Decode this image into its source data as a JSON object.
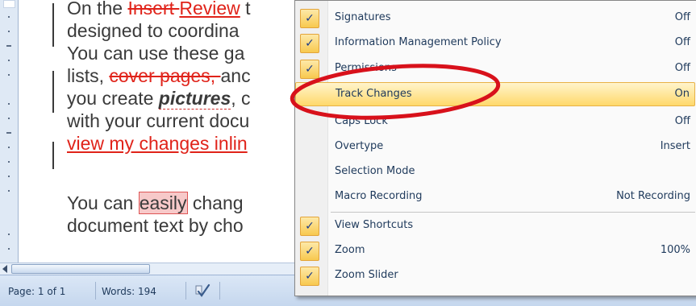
{
  "document": {
    "lines": [
      {
        "parts": [
          [
            "plain",
            "On the "
          ],
          [
            "del",
            "Insert "
          ],
          [
            "ins",
            "Review"
          ],
          [
            "plain",
            " t"
          ]
        ]
      },
      {
        "parts": [
          [
            "plain",
            "designed to coordina"
          ]
        ]
      },
      {
        "parts": [
          [
            "plain",
            "You can use these ga"
          ]
        ]
      },
      {
        "parts": [
          [
            "plain",
            "lists, "
          ],
          [
            "del",
            "cover pages, "
          ],
          [
            "plain",
            "anc"
          ]
        ]
      },
      {
        "parts": [
          [
            "plain",
            "you create "
          ],
          [
            "bold-it",
            "pictures"
          ],
          [
            "plain",
            ", c"
          ]
        ]
      },
      {
        "parts": [
          [
            "plain",
            "with your current docu"
          ]
        ]
      },
      {
        "parts": [
          [
            "red",
            "view my changes inlin"
          ]
        ]
      },
      {
        "parts": [
          [
            "plain",
            "You can "
          ],
          [
            "hl",
            "easily"
          ],
          [
            "plain",
            " chang"
          ]
        ]
      },
      {
        "parts": [
          [
            "plain",
            "document text by cho"
          ]
        ]
      }
    ]
  },
  "status_bar": {
    "page": "Page: 1 of 1",
    "words": "Words: 194"
  },
  "menu": {
    "items": [
      {
        "label": "Signatures",
        "value": "Off",
        "checked": true
      },
      {
        "label": "Information Management Policy",
        "value": "Off",
        "checked": true
      },
      {
        "label": "Permissions",
        "value": "Off",
        "checked": true
      },
      {
        "label": "Track Changes",
        "value": "On",
        "checked": false,
        "highlighted": true
      },
      {
        "label": "Caps Lock",
        "value": "Off",
        "checked": false
      },
      {
        "label": "Overtype",
        "value": "Insert",
        "checked": false
      },
      {
        "label": "Selection Mode",
        "value": "",
        "checked": false
      },
      {
        "label": "Macro Recording",
        "value": "Not Recording",
        "checked": false
      },
      {
        "label": "View Shortcuts",
        "value": "",
        "checked": true
      },
      {
        "label": "Zoom",
        "value": "100%",
        "checked": true
      },
      {
        "label": "Zoom Slider",
        "value": "",
        "checked": true
      }
    ],
    "check_glyph": "✓"
  },
  "colors": {
    "revision": "#e0231a",
    "highlight_item": "#ffd96b",
    "annotation_ellipse": "#d8111b"
  }
}
